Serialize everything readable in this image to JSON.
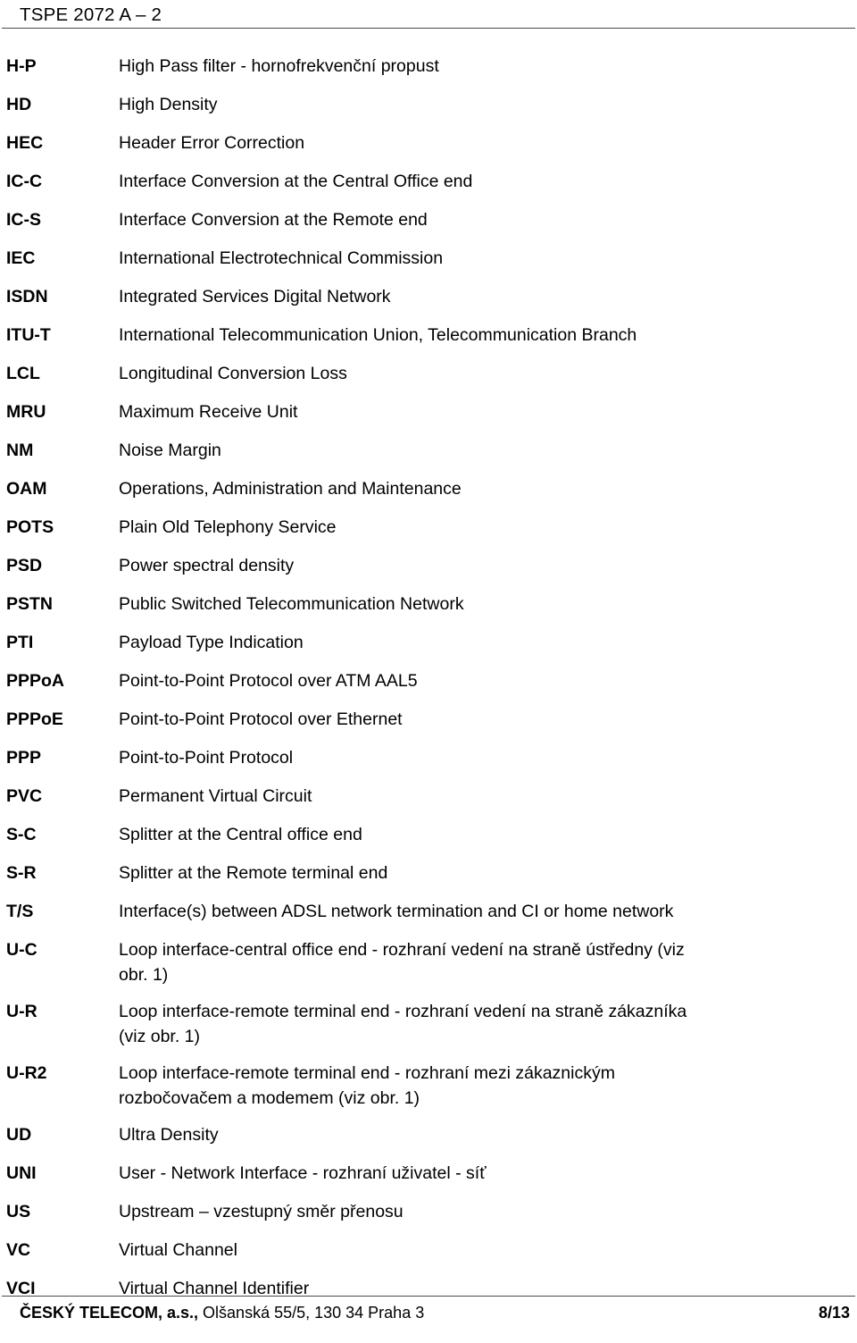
{
  "header": {
    "document_id": "TSPE 2072 A – 2"
  },
  "abbreviations": [
    {
      "term": "H-P",
      "definition": [
        "High Pass filter - hornofrekvenční propust"
      ]
    },
    {
      "term": "HD",
      "definition": [
        "High Density"
      ]
    },
    {
      "term": "HEC",
      "definition": [
        "Header Error Correction"
      ]
    },
    {
      "term": "IC-C",
      "definition": [
        "Interface Conversion at the Central Office end"
      ]
    },
    {
      "term": "IC-S",
      "definition": [
        "Interface Conversion at the Remote end"
      ]
    },
    {
      "term": "IEC",
      "definition": [
        "International Electrotechnical Commission"
      ]
    },
    {
      "term": "ISDN",
      "definition": [
        "Integrated Services Digital Network"
      ]
    },
    {
      "term": "ITU-T",
      "definition": [
        "International Telecommunication Union, Telecommunication Branch"
      ]
    },
    {
      "term": "LCL",
      "definition": [
        "Longitudinal Conversion Loss"
      ]
    },
    {
      "term": "MRU",
      "definition": [
        "Maximum Receive Unit"
      ]
    },
    {
      "term": "NM",
      "definition": [
        "Noise Margin"
      ]
    },
    {
      "term": "OAM",
      "definition": [
        "Operations, Administration and Maintenance"
      ]
    },
    {
      "term": "POTS",
      "definition": [
        "Plain Old Telephony Service"
      ]
    },
    {
      "term": "PSD",
      "definition": [
        "Power spectral density"
      ]
    },
    {
      "term": "PSTN",
      "definition": [
        "Public Switched Telecommunication Network"
      ]
    },
    {
      "term": "PTI",
      "definition": [
        "Payload Type Indication"
      ]
    },
    {
      "term": "PPPoA",
      "definition": [
        "Point-to-Point Protocol over ATM AAL5"
      ]
    },
    {
      "term": "PPPoE",
      "definition": [
        "Point-to-Point Protocol over Ethernet"
      ]
    },
    {
      "term": "PPP",
      "definition": [
        "Point-to-Point Protocol"
      ]
    },
    {
      "term": "PVC",
      "definition": [
        "Permanent Virtual Circuit"
      ]
    },
    {
      "term": "S-C",
      "definition": [
        "Splitter at the Central office end"
      ]
    },
    {
      "term": "S-R",
      "definition": [
        "Splitter at the Remote terminal end"
      ]
    },
    {
      "term": "T/S",
      "definition": [
        "Interface(s) between ADSL network termination and CI or home network"
      ]
    },
    {
      "term": "U-C",
      "definition": [
        "Loop interface-central office end - rozhraní vedení na straně ústředny (viz",
        "obr. 1)"
      ]
    },
    {
      "term": "U-R",
      "definition": [
        "Loop interface-remote terminal end - rozhraní vedení na straně zákazníka",
        "(viz obr. 1)"
      ]
    },
    {
      "term": "U-R2",
      "definition": [
        "Loop interface-remote terminal end - rozhraní mezi zákaznickým",
        "rozbočovačem a modemem (viz obr. 1)"
      ]
    },
    {
      "term": "UD",
      "definition": [
        "Ultra Density"
      ]
    },
    {
      "term": "UNI",
      "definition": [
        "User - Network Interface - rozhraní uživatel - síť"
      ]
    },
    {
      "term": "US",
      "definition": [
        "Upstream – vzestupný směr přenosu"
      ]
    },
    {
      "term": "VC",
      "definition": [
        "Virtual Channel"
      ]
    },
    {
      "term": "VCI",
      "definition": [
        "Virtual Channel Identifier"
      ]
    }
  ],
  "footer": {
    "company": "ČESKÝ TELECOM, a.s.,",
    "address": " Olšanská 55/5, 130 34 Praha 3",
    "page": "8/13"
  }
}
